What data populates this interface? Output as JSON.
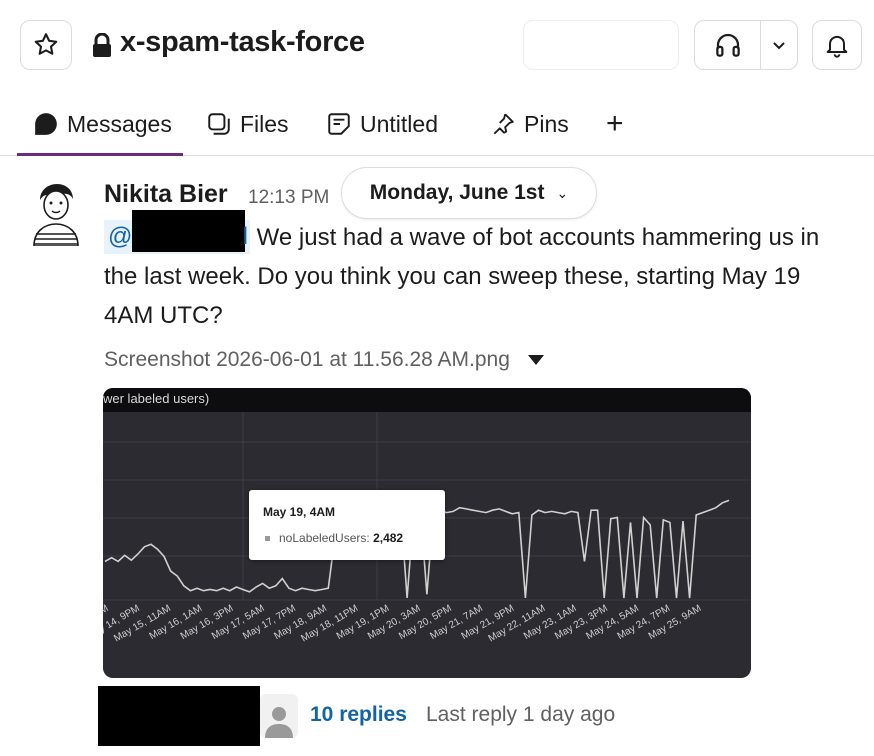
{
  "header": {
    "channel_name": "x-spam-task-force",
    "star_icon": "star-icon",
    "lock_icon": "lock-icon",
    "huddle_icon": "headphones-icon",
    "notifications_icon": "bell-icon"
  },
  "tabs": [
    {
      "label": "Messages",
      "icon": "messages-icon",
      "active": true
    },
    {
      "label": "Files",
      "icon": "files-icon"
    },
    {
      "label": "Untitled",
      "icon": "canvas-icon"
    },
    {
      "label": "Pins",
      "icon": "pin-icon"
    },
    {
      "label": "+",
      "icon": "add-tab-icon"
    }
  ],
  "accent_color": "#6b2d7b",
  "message": {
    "author": "Nikita Bier",
    "time": "12:13 PM",
    "date_divider": "Monday, June 1st",
    "mention_prefix": "@",
    "text_line1": "We just had a wave of bot accounts hammering us in",
    "text_line2": "the last week. Do you think you can sweep these, starting May 19",
    "text_line3": "4AM UTC?",
    "file_name": "Screenshot 2026-06-01 at 11.56.28 AM.png"
  },
  "chart_data": {
    "type": "line",
    "title": "wer labeled users)",
    "series": [
      {
        "name": "noLabeledUsers"
      }
    ],
    "tooltip": {
      "title": "May 19, 4AM",
      "label": "noLabeledUsers:",
      "value": "2,482"
    },
    "x_tick_labels": [
      "AM",
      "y 14, 9PM",
      "May 15, 11AM",
      "May 16, 1AM",
      "May 16, 3PM",
      "May 17, 5AM",
      "May 17, 7PM",
      "May 18, 9AM",
      "May 18, 11PM",
      "May 19, 1PM",
      "May 20, 3AM",
      "May 20, 5PM",
      "May 21, 7AM",
      "May 21, 9PM",
      "May 22, 11AM",
      "May 23, 1AM",
      "May 23, 3PM",
      "May 24, 5AM",
      "May 24, 7PM",
      "May 25, 9AM"
    ],
    "y_relative": [
      0.3,
      0.33,
      0.3,
      0.35,
      0.31,
      0.36,
      0.42,
      0.44,
      0.4,
      0.34,
      0.22,
      0.18,
      0.1,
      0.06,
      0.08,
      0.06,
      0.07,
      0.06,
      0.08,
      0.06,
      0.09,
      0.07,
      0.05,
      0.09,
      0.12,
      0.08,
      0.1,
      0.16,
      0.08,
      0.06,
      0.08,
      0.07,
      0.06,
      0.07,
      0.08,
      0.5,
      0.68,
      0.76,
      0.7,
      0.73,
      0.72,
      0.75,
      0.7,
      0.73,
      0.71,
      0.74,
      0.0,
      0.7,
      0.73,
      0.03,
      0.7,
      0.72,
      0.7,
      0.71,
      0.74,
      0.73,
      0.72,
      0.71,
      0.7,
      0.72,
      0.73,
      0.71,
      0.69,
      0.7,
      0.0,
      0.68,
      0.72,
      0.7,
      0.71,
      0.7,
      0.69,
      0.71,
      0.7,
      0.3,
      0.72,
      0.72,
      0.0,
      0.65,
      0.66,
      0.0,
      0.62,
      0.0,
      0.66,
      0.6,
      0.0,
      0.64,
      0.62,
      0.0,
      0.63,
      0.0,
      0.68,
      0.7,
      0.72,
      0.74,
      0.78,
      0.8
    ],
    "grid": true,
    "line_color": "#d0d0d0"
  },
  "replies": {
    "count_label": "10 replies",
    "last_reply": "Last reply 1 day ago"
  }
}
